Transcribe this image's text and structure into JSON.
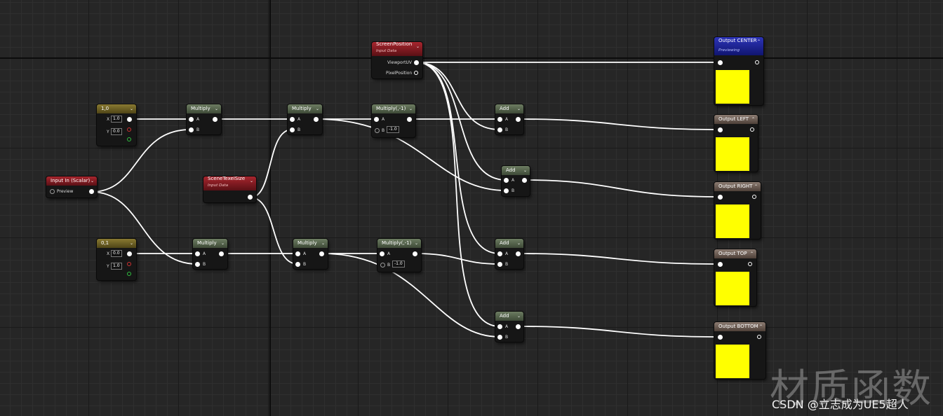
{
  "nodes": {
    "const10": {
      "title": "1,0",
      "x_label": "X",
      "x_value": "1.0",
      "y_label": "Y",
      "y_value": "0.0"
    },
    "const01": {
      "title": "0,1",
      "x_label": "X",
      "x_value": "0.0",
      "y_label": "Y",
      "y_value": "1.0"
    },
    "input_in": {
      "title": "Input In (Scalar)",
      "pin": "Preview"
    },
    "texel": {
      "title": "SceneTexelSize",
      "subtitle": "Input Data"
    },
    "screenpos": {
      "title": "ScreenPosition",
      "subtitle": "Input Data",
      "out1": "ViewportUV",
      "out2": "PixelPosition"
    },
    "mul1": {
      "title": "Multiply",
      "a": "A",
      "b": "B"
    },
    "mul2": {
      "title": "Multiply",
      "a": "A",
      "b": "B"
    },
    "mul3": {
      "title": "Multiply",
      "a": "A",
      "b": "B"
    },
    "mul4": {
      "title": "Multiply",
      "a": "A",
      "b": "B"
    },
    "muln1": {
      "title": "Multiply(,-1)",
      "a": "A",
      "b": "B",
      "b_value": "-1.0"
    },
    "muln2": {
      "title": "Multiply(,-1)",
      "a": "A",
      "b": "B",
      "b_value": "-1.0"
    },
    "add1": {
      "title": "Add",
      "a": "A",
      "b": "B"
    },
    "add2": {
      "title": "Add",
      "a": "A",
      "b": "B"
    },
    "add3": {
      "title": "Add",
      "a": "A",
      "b": "B"
    },
    "add4": {
      "title": "Add",
      "a": "A",
      "b": "B"
    },
    "out_center": {
      "title": "Output CENTER",
      "subtitle": "Previewing"
    },
    "out_left": {
      "title": "Output LEFT"
    },
    "out_right": {
      "title": "Output RIGHT"
    },
    "out_top": {
      "title": "Output TOP"
    },
    "out_bottom": {
      "title": "Output BOTTOM"
    }
  },
  "colors": {
    "swatch": "#ffff00",
    "wire": "#ffffff"
  },
  "watermark": {
    "large": "材质函数",
    "small": "CSDN @立志成为UE5超人"
  }
}
